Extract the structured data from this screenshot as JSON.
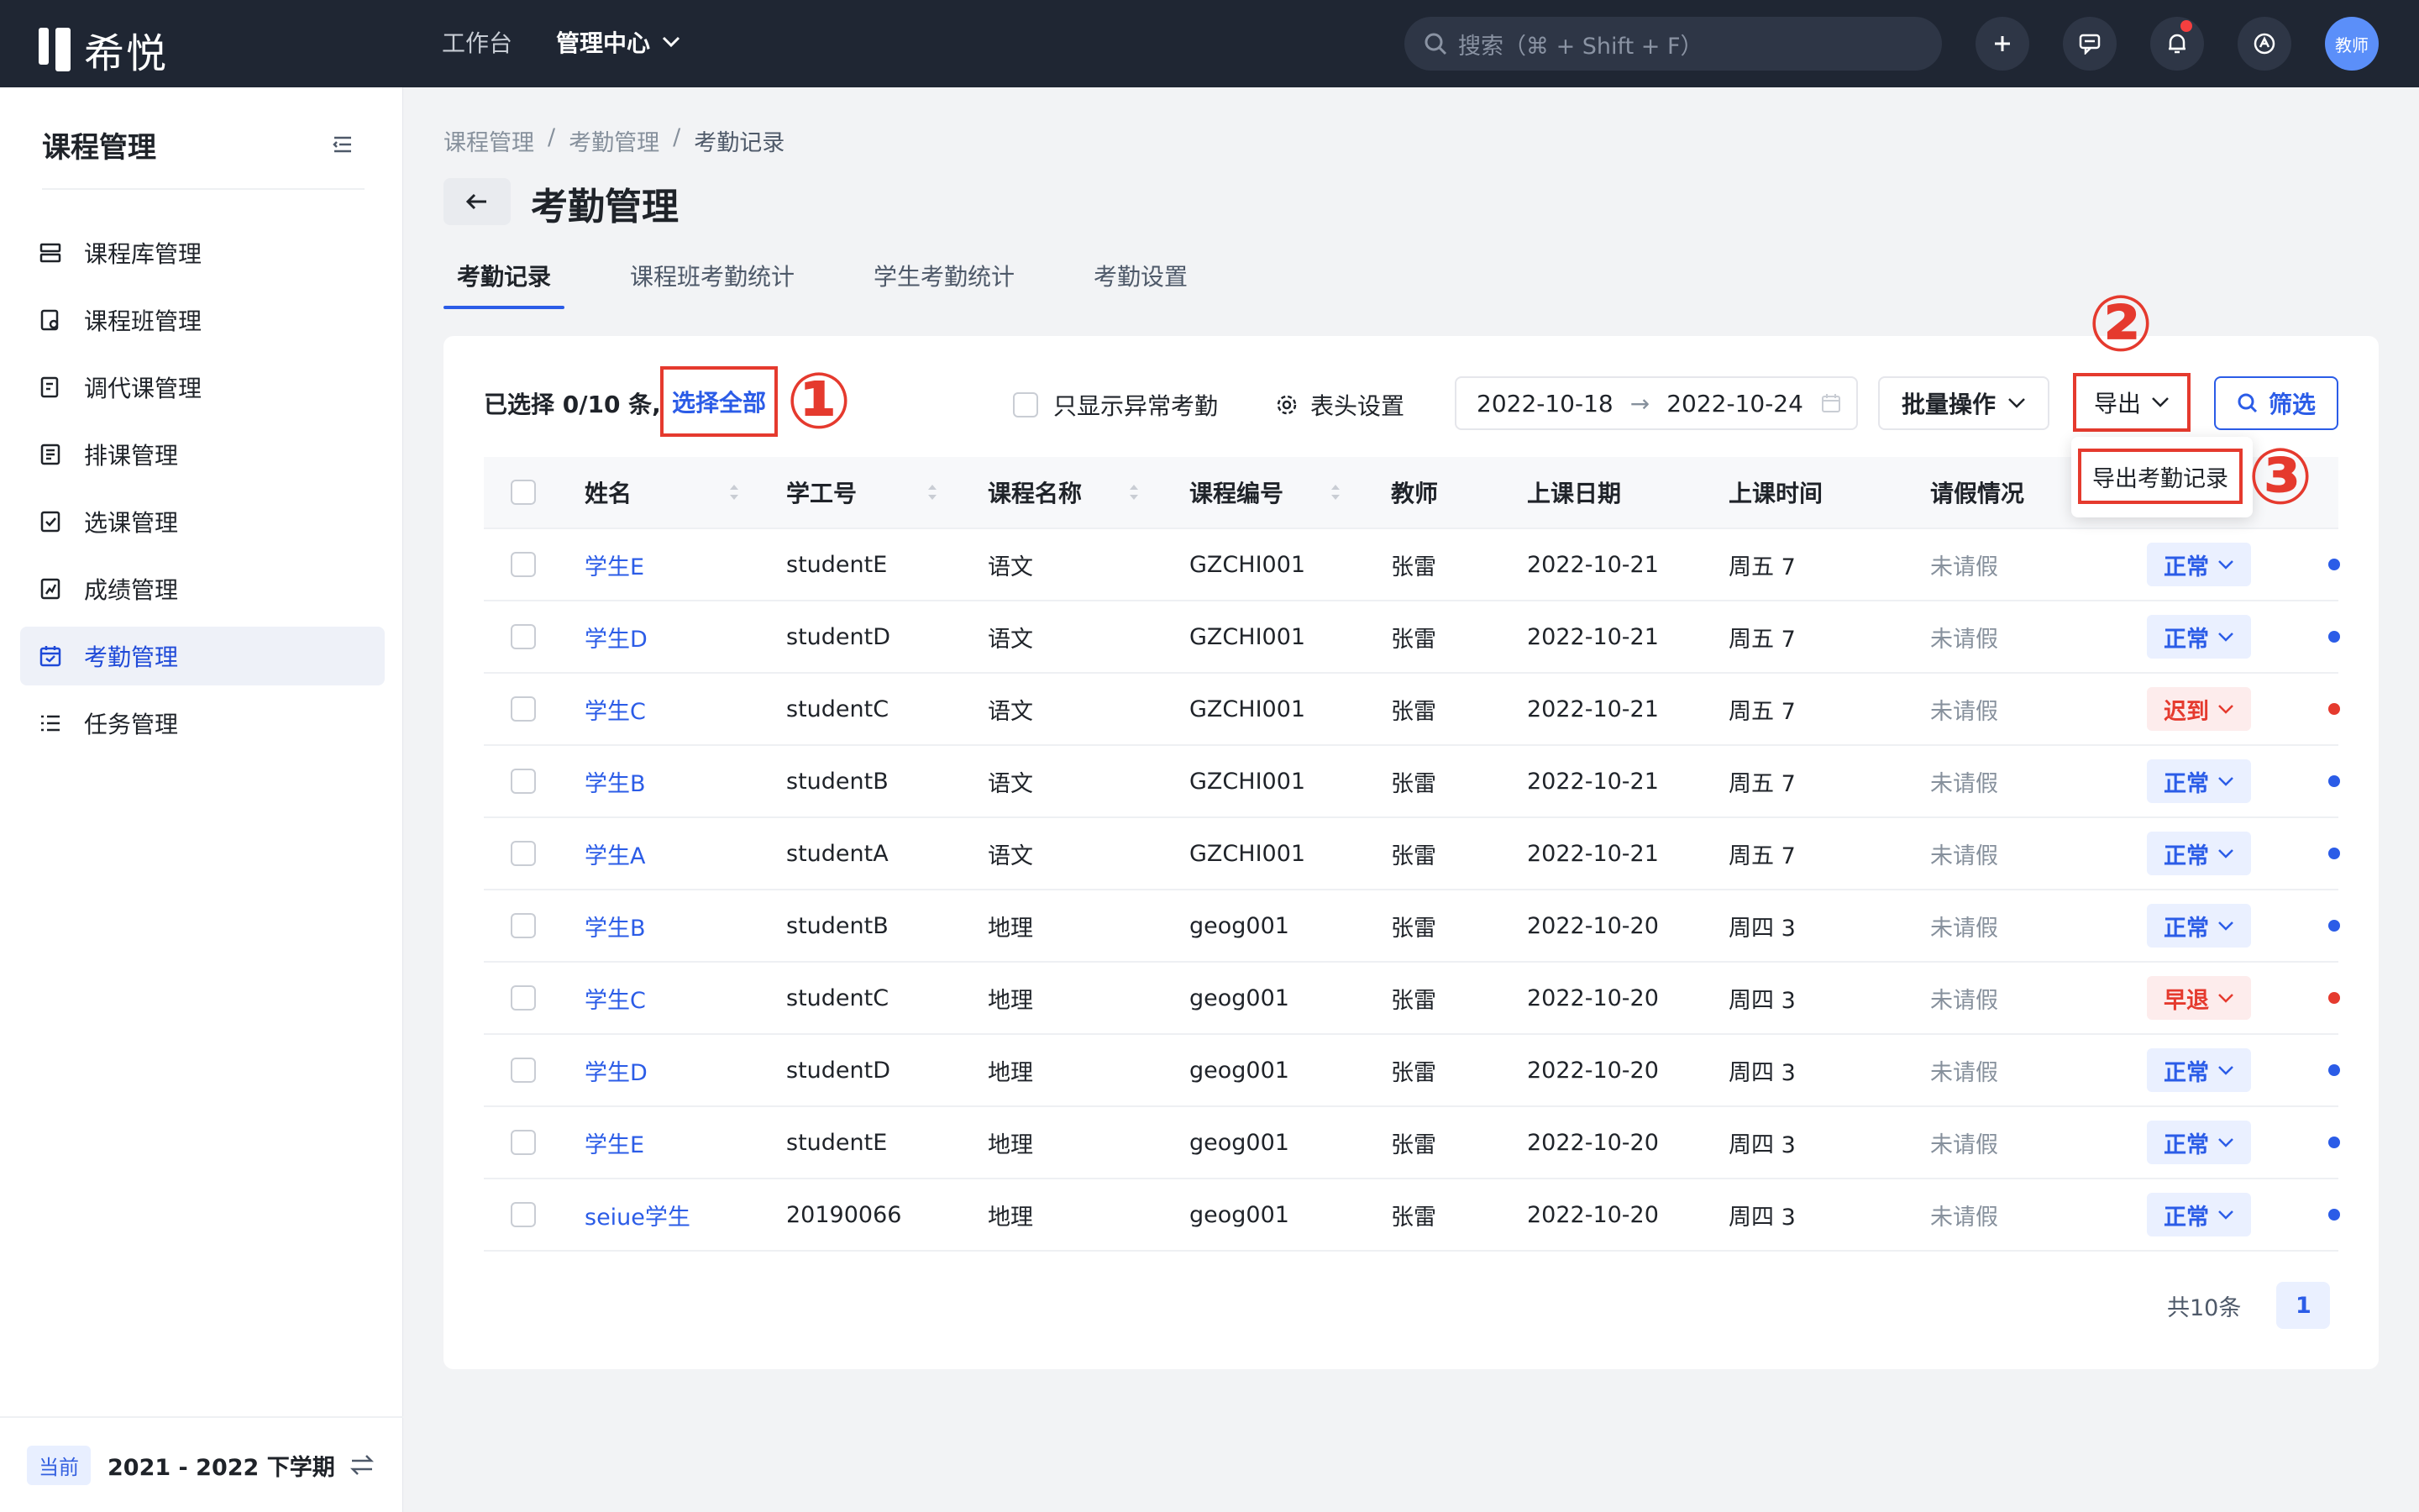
{
  "topbar": {
    "logo_text": "希悦",
    "nav": [
      {
        "label": "工作台"
      },
      {
        "label": "管理中心"
      }
    ],
    "search_placeholder": "搜索（⌘ + Shift + F）",
    "avatar_label": "教师",
    "icons": [
      "plus-icon",
      "message-icon",
      "bell-icon",
      "help-icon"
    ]
  },
  "sidebar": {
    "title": "课程管理",
    "items": [
      {
        "label": "课程库管理",
        "icon": "library-icon"
      },
      {
        "label": "课程班管理",
        "icon": "class-icon"
      },
      {
        "label": "调代课管理",
        "icon": "substitute-icon"
      },
      {
        "label": "排课管理",
        "icon": "schedule-icon"
      },
      {
        "label": "选课管理",
        "icon": "select-course-icon"
      },
      {
        "label": "成绩管理",
        "icon": "grade-icon"
      },
      {
        "label": "考勤管理",
        "icon": "calendar-icon"
      },
      {
        "label": "任务管理",
        "icon": "task-list-icon"
      }
    ],
    "term_badge": "当前",
    "term_text": "2021 - 2022 下学期"
  },
  "breadcrumb": [
    "课程管理",
    "考勤管理",
    "考勤记录"
  ],
  "page_title": "考勤管理",
  "tabs": [
    "考勤记录",
    "课程班考勤统计",
    "学生考勤统计",
    "考勤设置"
  ],
  "toolbar": {
    "selection_info": "已选择 0/10 条,",
    "select_all": "选择全部",
    "only_abnormal": "只显示异常考勤",
    "column_settings": "表头设置",
    "date_start": "2022-10-18",
    "date_arrow": "→",
    "date_end": "2022-10-24",
    "batch": "批量操作",
    "export": "导出",
    "filter": "筛选"
  },
  "export_menu": {
    "item": "导出考勤记录"
  },
  "annotations": [
    "①",
    "②",
    "③"
  ],
  "table": {
    "headers": [
      "姓名",
      "学工号",
      "课程名称",
      "课程编号",
      "教师",
      "上课日期",
      "上课时间",
      "请假情况"
    ],
    "rows": [
      {
        "name": "学生E",
        "id": "studentE",
        "course": "语文",
        "code": "GZCHI001",
        "teacher": "张雷",
        "date": "2022-10-21",
        "time": "周五 7",
        "leave": "未请假",
        "status": "正常",
        "kind": "normal"
      },
      {
        "name": "学生D",
        "id": "studentD",
        "course": "语文",
        "code": "GZCHI001",
        "teacher": "张雷",
        "date": "2022-10-21",
        "time": "周五 7",
        "leave": "未请假",
        "status": "正常",
        "kind": "normal"
      },
      {
        "name": "学生C",
        "id": "studentC",
        "course": "语文",
        "code": "GZCHI001",
        "teacher": "张雷",
        "date": "2022-10-21",
        "time": "周五 7",
        "leave": "未请假",
        "status": "迟到",
        "kind": "warn"
      },
      {
        "name": "学生B",
        "id": "studentB",
        "course": "语文",
        "code": "GZCHI001",
        "teacher": "张雷",
        "date": "2022-10-21",
        "time": "周五 7",
        "leave": "未请假",
        "status": "正常",
        "kind": "normal"
      },
      {
        "name": "学生A",
        "id": "studentA",
        "course": "语文",
        "code": "GZCHI001",
        "teacher": "张雷",
        "date": "2022-10-21",
        "time": "周五 7",
        "leave": "未请假",
        "status": "正常",
        "kind": "normal"
      },
      {
        "name": "学生B",
        "id": "studentB",
        "course": "地理",
        "code": "geog001",
        "teacher": "张雷",
        "date": "2022-10-20",
        "time": "周四 3",
        "leave": "未请假",
        "status": "正常",
        "kind": "normal"
      },
      {
        "name": "学生C",
        "id": "studentC",
        "course": "地理",
        "code": "geog001",
        "teacher": "张雷",
        "date": "2022-10-20",
        "time": "周四 3",
        "leave": "未请假",
        "status": "早退",
        "kind": "warn"
      },
      {
        "name": "学生D",
        "id": "studentD",
        "course": "地理",
        "code": "geog001",
        "teacher": "张雷",
        "date": "2022-10-20",
        "time": "周四 3",
        "leave": "未请假",
        "status": "正常",
        "kind": "normal"
      },
      {
        "name": "学生E",
        "id": "studentE",
        "course": "地理",
        "code": "geog001",
        "teacher": "张雷",
        "date": "2022-10-20",
        "time": "周四 3",
        "leave": "未请假",
        "status": "正常",
        "kind": "normal"
      },
      {
        "name": "seiue学生",
        "id": "20190066",
        "course": "地理",
        "code": "geog001",
        "teacher": "张雷",
        "date": "2022-10-20",
        "time": "周四 3",
        "leave": "未请假",
        "status": "正常",
        "kind": "normal"
      }
    ]
  },
  "pagination": {
    "total": "共10条",
    "current": "1"
  },
  "colors": {
    "topbar": "#1f2633",
    "accent": "#2b5ce7",
    "annotation_red": "#e53a2e",
    "warn": "#e53a2e"
  }
}
